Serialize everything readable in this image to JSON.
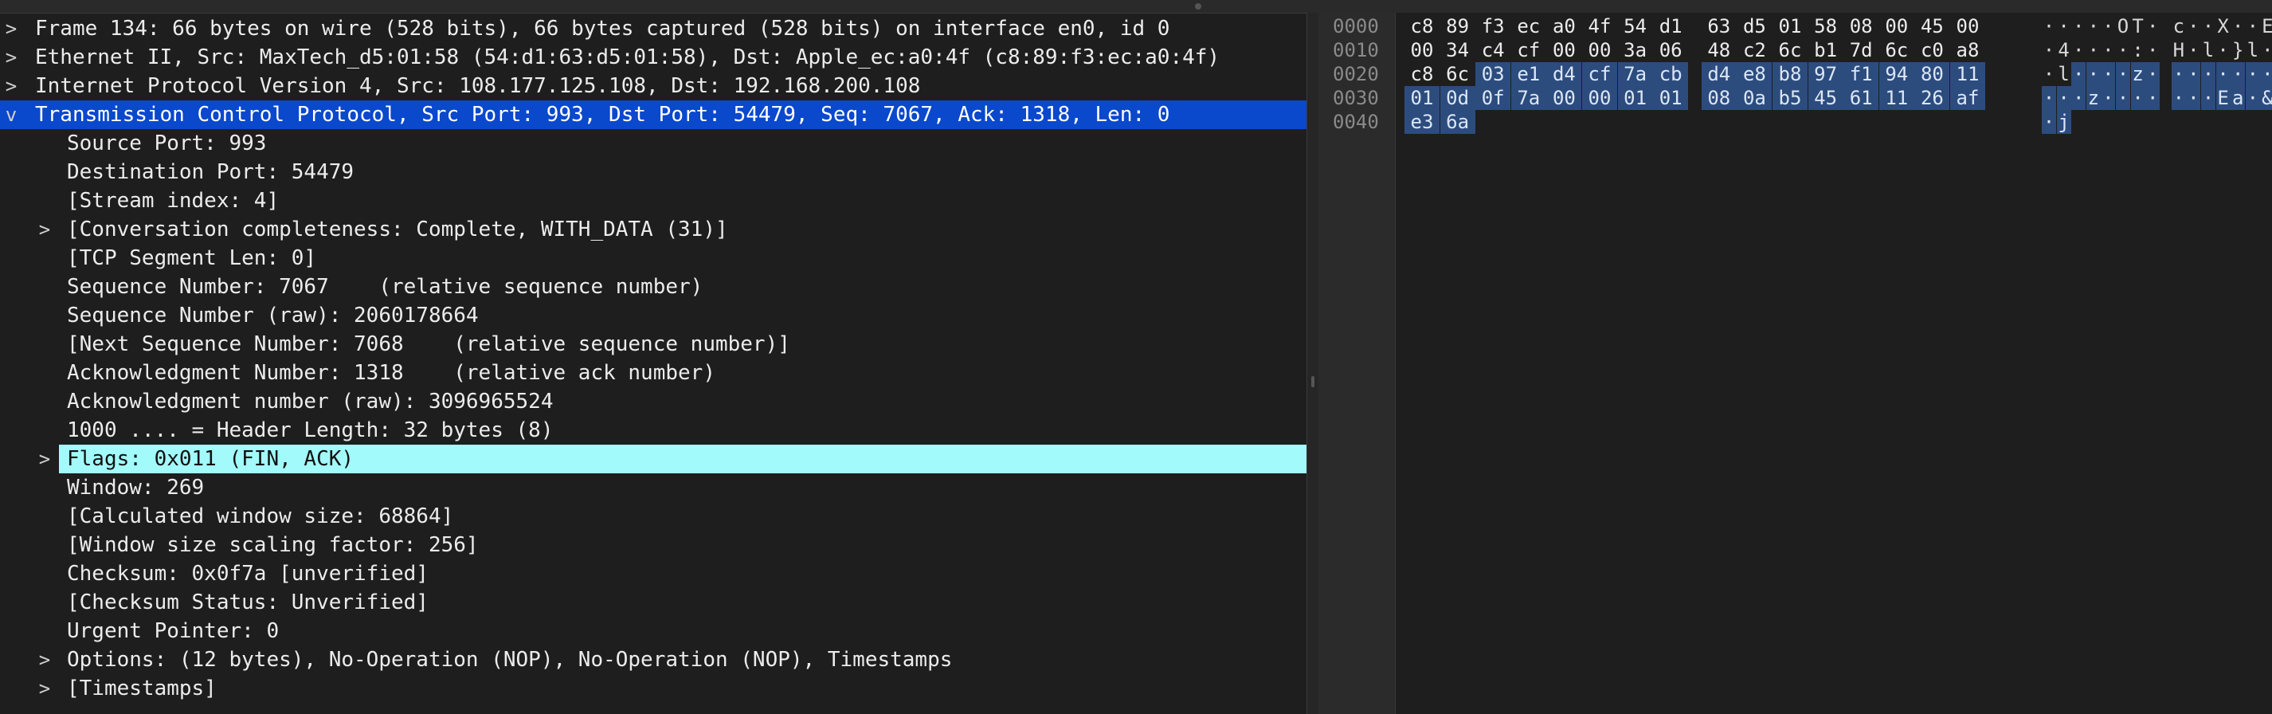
{
  "tree": {
    "rows": [
      {
        "text": "Frame 134: 66 bytes on wire (528 bits), 66 bytes captured (528 bits) on interface en0, id 0",
        "chevron": ">",
        "indent": 0
      },
      {
        "text": "Ethernet II, Src: MaxTech_d5:01:58 (54:d1:63:d5:01:58), Dst: Apple_ec:a0:4f (c8:89:f3:ec:a0:4f)",
        "chevron": ">",
        "indent": 0
      },
      {
        "text": "Internet Protocol Version 4, Src: 108.177.125.108, Dst: 192.168.200.108",
        "chevron": ">",
        "indent": 0
      },
      {
        "text": "Transmission Control Protocol, Src Port: 993, Dst Port: 54479, Seq: 7067, Ack: 1318, Len: 0",
        "chevron": "v",
        "indent": 0
      },
      {
        "text": "Source Port: 993",
        "chevron": "",
        "indent": 1
      },
      {
        "text": "Destination Port: 54479",
        "chevron": "",
        "indent": 1
      },
      {
        "text": "[Stream index: 4]",
        "chevron": "",
        "indent": 1
      },
      {
        "text": "[Conversation completeness: Complete, WITH_DATA (31)]",
        "chevron": ">",
        "indent": 1
      },
      {
        "text": "[TCP Segment Len: 0]",
        "chevron": "",
        "indent": 1
      },
      {
        "text": "Sequence Number: 7067    (relative sequence number)",
        "chevron": "",
        "indent": 1
      },
      {
        "text": "Sequence Number (raw): 2060178664",
        "chevron": "",
        "indent": 1
      },
      {
        "text": "[Next Sequence Number: 7068    (relative sequence number)]",
        "chevron": "",
        "indent": 1
      },
      {
        "text": "Acknowledgment Number: 1318    (relative ack number)",
        "chevron": "",
        "indent": 1
      },
      {
        "text": "Acknowledgment number (raw): 3096965524",
        "chevron": "",
        "indent": 1
      },
      {
        "text": "1000 .... = Header Length: 32 bytes (8)",
        "chevron": "",
        "indent": 1
      },
      {
        "text": "Flags: 0x011 (FIN, ACK)",
        "chevron": ">",
        "indent": 1
      },
      {
        "text": "Window: 269",
        "chevron": "",
        "indent": 1
      },
      {
        "text": "[Calculated window size: 68864]",
        "chevron": "",
        "indent": 1
      },
      {
        "text": "[Window size scaling factor: 256]",
        "chevron": "",
        "indent": 1
      },
      {
        "text": "Checksum: 0x0f7a [unverified]",
        "chevron": "",
        "indent": 1
      },
      {
        "text": "[Checksum Status: Unverified]",
        "chevron": "",
        "indent": 1
      },
      {
        "text": "Urgent Pointer: 0",
        "chevron": "",
        "indent": 1
      },
      {
        "text": "Options: (12 bytes), No-Operation (NOP), No-Operation (NOP), Timestamps",
        "chevron": ">",
        "indent": 1
      },
      {
        "text": "[Timestamps]",
        "chevron": ">",
        "indent": 1
      }
    ],
    "selected_row_color": "#0a48cc",
    "focused_field_color": "#a3fafb"
  },
  "hex": {
    "highlight_color": "#2c4c7e",
    "lines": [
      {
        "offset": "0000",
        "bytes": [
          "c8",
          "89",
          "f3",
          "ec",
          "a0",
          "4f",
          "54",
          "d1",
          "63",
          "d5",
          "01",
          "58",
          "08",
          "00",
          "45",
          "00"
        ],
        "ascii": [
          "·",
          "·",
          "·",
          "·",
          "·",
          "O",
          "T",
          "·",
          "c",
          "·",
          "·",
          "X",
          "·",
          "·",
          "E",
          "·"
        ]
      },
      {
        "offset": "0010",
        "bytes": [
          "00",
          "34",
          "c4",
          "cf",
          "00",
          "00",
          "3a",
          "06",
          "48",
          "c2",
          "6c",
          "b1",
          "7d",
          "6c",
          "c0",
          "a8"
        ],
        "ascii": [
          "·",
          "4",
          "·",
          "·",
          "·",
          "·",
          ":",
          "·",
          "H",
          "·",
          "l",
          "·",
          "}",
          "l",
          "·",
          "·"
        ]
      },
      {
        "offset": "0020",
        "bytes": [
          "c8",
          "6c",
          "03",
          "e1",
          "d4",
          "cf",
          "7a",
          "cb",
          "d4",
          "e8",
          "b8",
          "97",
          "f1",
          "94",
          "80",
          "11"
        ],
        "ascii": [
          "·",
          "l",
          "·",
          "·",
          "·",
          "·",
          "z",
          "·",
          "·",
          "·",
          "·",
          "·",
          "·",
          "·",
          "·",
          "·"
        ]
      },
      {
        "offset": "0030",
        "bytes": [
          "01",
          "0d",
          "0f",
          "7a",
          "00",
          "00",
          "01",
          "01",
          "08",
          "0a",
          "b5",
          "45",
          "61",
          "11",
          "26",
          "af"
        ],
        "ascii": [
          "·",
          "·",
          "·",
          "z",
          "·",
          "·",
          "·",
          "·",
          "·",
          "·",
          "·",
          "E",
          "a",
          "·",
          "&",
          "·"
        ]
      },
      {
        "offset": "0040",
        "bytes": [
          "e3",
          "6a"
        ],
        "ascii": [
          "·",
          "j"
        ]
      }
    ],
    "highlight_from_line": 2,
    "highlight_from_index": 2
  }
}
